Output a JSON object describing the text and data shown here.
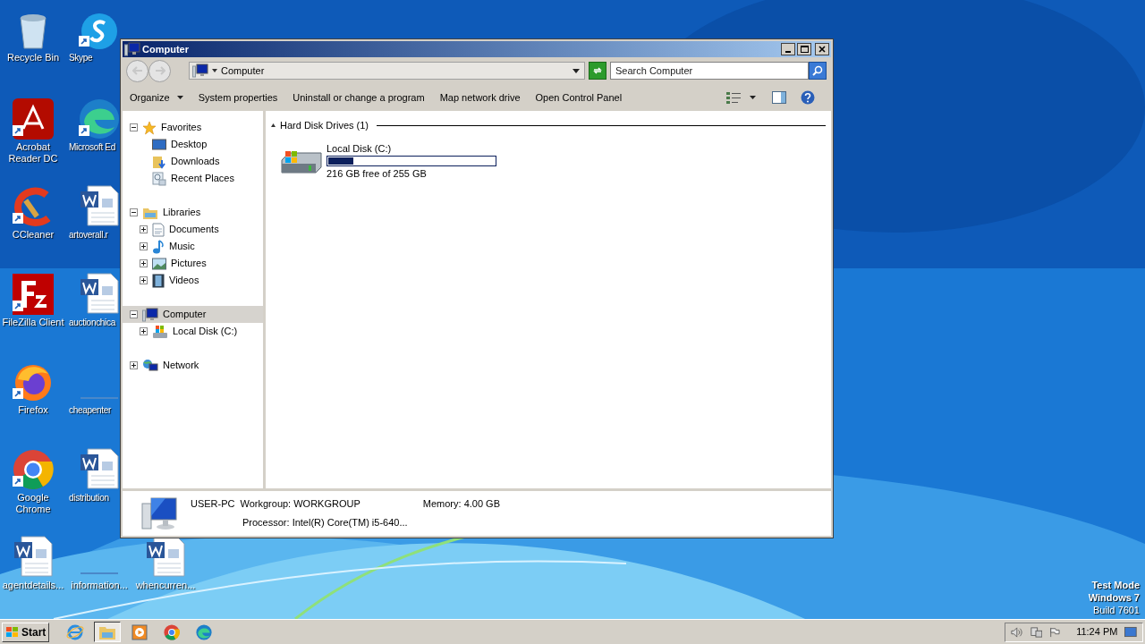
{
  "desktop_icons": [
    {
      "label": "Recycle Bin",
      "kind": "recycle"
    },
    {
      "label": "Skype",
      "kind": "skype"
    },
    {
      "label": "Acrobat Reader DC",
      "kind": "acrobat"
    },
    {
      "label": "Microsoft Ed",
      "kind": "edge"
    },
    {
      "label": "CCleaner",
      "kind": "ccleaner"
    },
    {
      "label": "artoverall.r",
      "kind": "word"
    },
    {
      "label": "FileZilla Client",
      "kind": "filezilla"
    },
    {
      "label": "auctionchica",
      "kind": "word"
    },
    {
      "label": "Firefox",
      "kind": "firefox"
    },
    {
      "label": "cheapenter",
      "kind": "blank"
    },
    {
      "label": "Google Chrome",
      "kind": "chrome"
    },
    {
      "label": "distribution",
      "kind": "word"
    },
    {
      "label": "agentdetails...",
      "kind": "word"
    },
    {
      "label": "information...",
      "kind": "blank"
    },
    {
      "label": "whencurren...",
      "kind": "word"
    }
  ],
  "window": {
    "title": "Computer",
    "address": "Computer",
    "search": {
      "placeholder": "Search Computer"
    },
    "toolbar": [
      "Organize",
      "System properties",
      "Uninstall or change a program",
      "Map network drive",
      "Open Control Panel"
    ],
    "nav_tree": [
      {
        "label": "Favorites",
        "kind": "star",
        "expanded": true,
        "selected": false,
        "children": [
          {
            "label": "Desktop",
            "kind": "desktop",
            "selected": false
          },
          {
            "label": "Downloads",
            "kind": "downloads",
            "selected": false
          },
          {
            "label": "Recent Places",
            "kind": "recent",
            "selected": false
          }
        ]
      },
      {
        "label": "Libraries",
        "kind": "library",
        "expanded": true,
        "selected": false,
        "children": [
          {
            "label": "Documents",
            "kind": "documents",
            "expanded": false,
            "selected": false
          },
          {
            "label": "Music",
            "kind": "music",
            "expanded": false,
            "selected": false
          },
          {
            "label": "Pictures",
            "kind": "pictures",
            "expanded": false,
            "selected": false
          },
          {
            "label": "Videos",
            "kind": "videos",
            "expanded": false,
            "selected": false
          }
        ]
      },
      {
        "label": "Computer",
        "kind": "computer",
        "expanded": true,
        "selected": true,
        "children": [
          {
            "label": "Local Disk (C:)",
            "kind": "disk",
            "expanded": false,
            "selected": false
          }
        ]
      },
      {
        "label": "Network",
        "kind": "network",
        "expanded": false,
        "selected": false
      }
    ],
    "group": {
      "title": "Hard Disk Drives (1)",
      "expanded": true
    },
    "drives": [
      {
        "name": "Local Disk (C:)",
        "level": 0.15,
        "free": "216 GB free of 255 GB"
      }
    ],
    "details": {
      "name": "USER-PC",
      "workgroup": "Workgroup: WORKGROUP",
      "memory": "Memory: 4.00 GB",
      "processor": "Processor: Intel(R) Core(TM) i5-640..."
    }
  },
  "watermark_text": [
    "Test Mode",
    "Windows 7",
    "Build 7601"
  ],
  "taskbar": {
    "start": "Start",
    "apps": [
      {
        "kind": "ie",
        "selected": false
      },
      {
        "kind": "explorer",
        "selected": true
      },
      {
        "kind": "media",
        "selected": false
      },
      {
        "kind": "chrome",
        "selected": false
      },
      {
        "kind": "edge",
        "selected": false
      }
    ],
    "clock": "11:24 PM"
  }
}
